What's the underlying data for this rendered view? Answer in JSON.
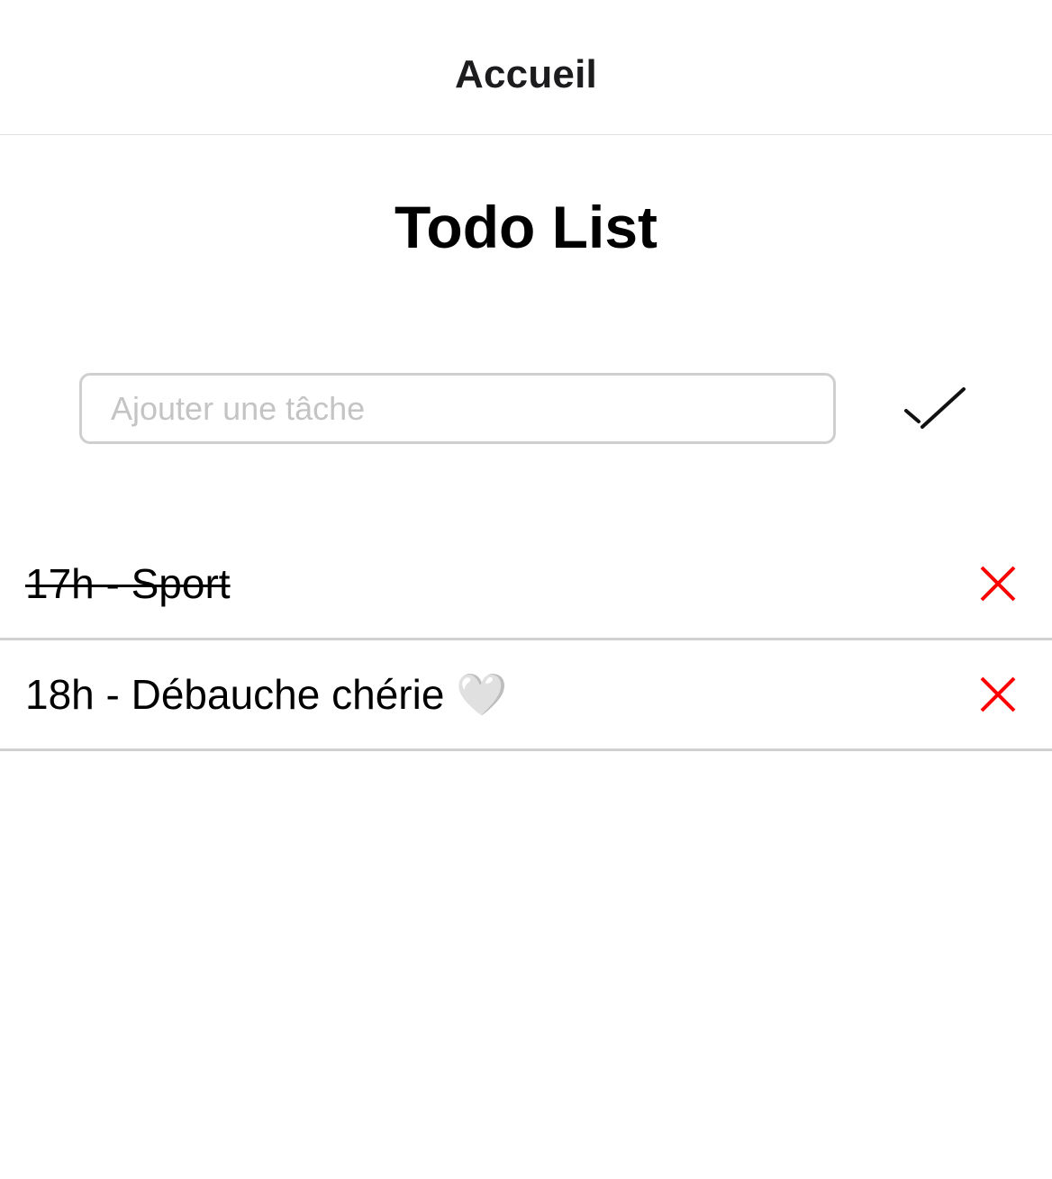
{
  "nav": {
    "title": "Accueil"
  },
  "main": {
    "title": "Todo List",
    "input": {
      "placeholder": "Ajouter une tâche",
      "value": ""
    },
    "submit_icon": "checkmark-icon"
  },
  "todos": [
    {
      "text": "17h - Sport",
      "done": true,
      "delete_icon": "close-icon"
    },
    {
      "text": "18h - Débauche chérie 🤍",
      "done": false,
      "delete_icon": "close-icon"
    }
  ],
  "colors": {
    "delete": "#ff0000",
    "divider": "#d0d0d0",
    "input_border": "#cfcfcf",
    "placeholder": "#c4c4c4"
  }
}
